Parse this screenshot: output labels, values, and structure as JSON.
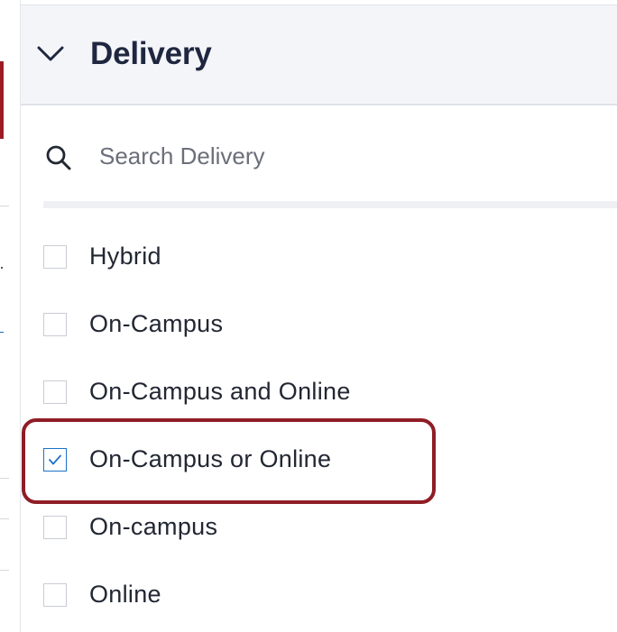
{
  "filter": {
    "title": "Delivery",
    "search": {
      "placeholder": "Search Delivery",
      "value": ""
    },
    "options": [
      {
        "label": "Hybrid",
        "checked": false
      },
      {
        "label": "On-Campus",
        "checked": false
      },
      {
        "label": "On-Campus and Online",
        "checked": false
      },
      {
        "label": "On-Campus or Online",
        "checked": true
      },
      {
        "label": "On-campus",
        "checked": false
      },
      {
        "label": "Online",
        "checked": false
      }
    ]
  },
  "icons": {
    "collapse": "chevron-down-icon",
    "search": "search-icon",
    "check": "checkmark-icon"
  },
  "colors": {
    "header_bg": "#f4f5f9",
    "title_text": "#1f2740",
    "checkbox_border": "#c9ccd3",
    "checked_accent": "#1a73c9",
    "highlight_annotation": "#8f1d26"
  }
}
